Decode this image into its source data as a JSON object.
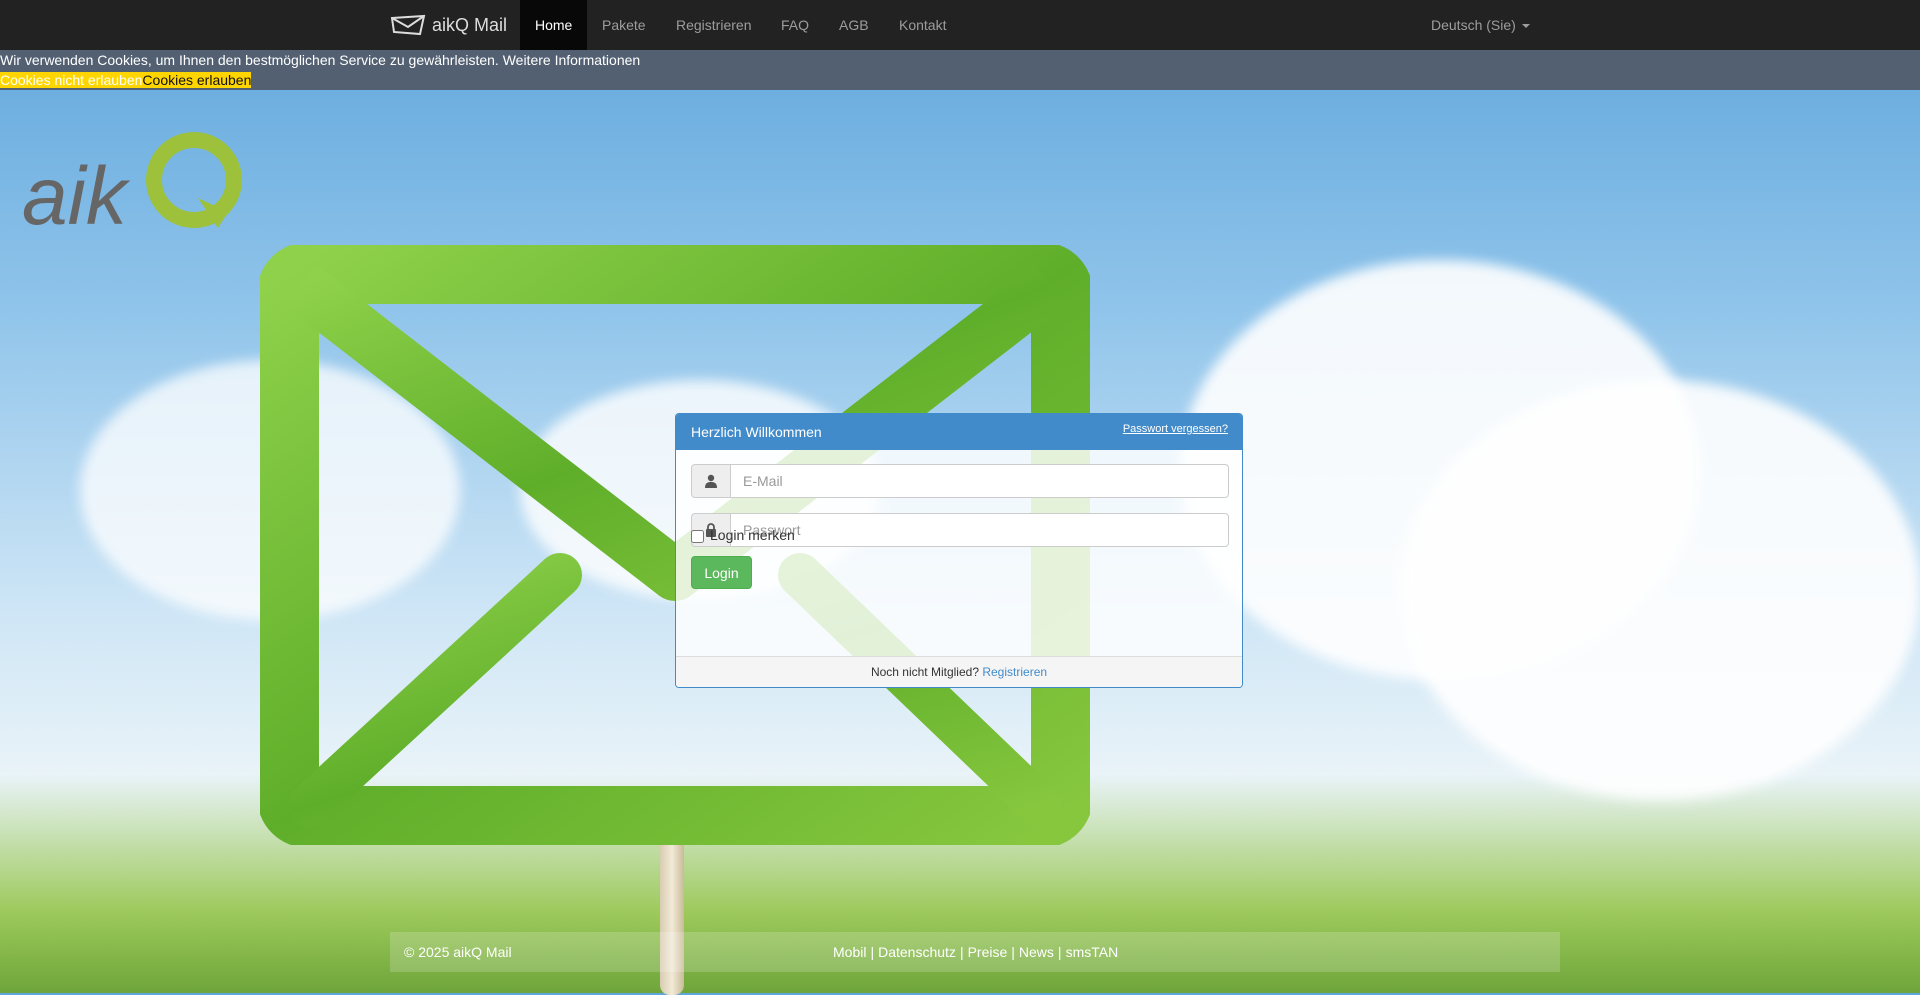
{
  "navbar": {
    "brand": "aikQ Mail",
    "items": [
      {
        "label": "Home",
        "active": true
      },
      {
        "label": "Pakete"
      },
      {
        "label": "Registrieren"
      },
      {
        "label": "FAQ"
      },
      {
        "label": "AGB"
      },
      {
        "label": "Kontakt"
      }
    ],
    "language": "Deutsch (Sie)"
  },
  "cookie_banner": {
    "text": "Wir verwenden Cookies, um Ihnen den bestmöglichen Service zu gewährleisten.",
    "more_info": "Weitere Informationen",
    "deny_label": "Cookies nicht erlauben",
    "allow_label": "Cookies erlauben"
  },
  "logo": {
    "text": "aikQ"
  },
  "login_panel": {
    "title": "Herzlich Willkommen",
    "forgot_password": "Passwort vergessen?",
    "email_placeholder": "E-Mail",
    "password_placeholder": "Passwort",
    "remember_label": "Login merken",
    "login_button": "Login",
    "not_member": "Noch nicht Mitglied?",
    "register_link": "Registrieren"
  },
  "footer": {
    "copyright": "© 2025 aikQ Mail",
    "links": [
      "Mobil",
      "Datenschutz",
      "Preise",
      "News",
      "smsTAN"
    ]
  },
  "colors": {
    "navbar_bg": "#222222",
    "panel_primary": "#428bca",
    "login_green": "#5cb85c",
    "cookie_yellow": "#ffd500",
    "brand_green": "#9dc13b"
  }
}
